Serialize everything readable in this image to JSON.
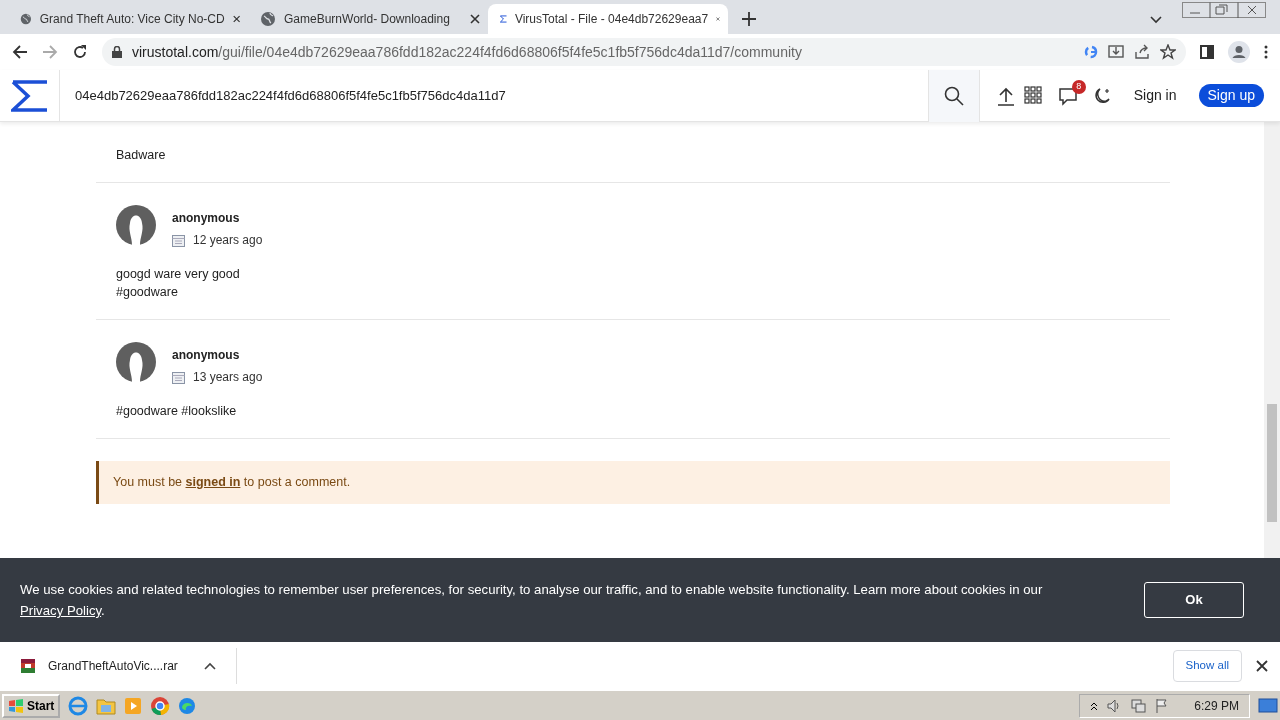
{
  "browser": {
    "tabs": [
      {
        "title": "Grand Theft Auto: Vice City No-CD",
        "kind": "generic",
        "selected": false
      },
      {
        "title": "GameBurnWorld- Downloading",
        "kind": "generic",
        "selected": false
      },
      {
        "title": "VirusTotal - File - 04e4db72629eaa7",
        "kind": "favicon",
        "selected": true
      }
    ],
    "address": {
      "domain": "virustotal.com",
      "path": "/gui/file/04e4db72629eaa786fdd182ac224f4fd6d68806f5f4fe5c1fb5f756dc4da11d7/community"
    }
  },
  "site_header": {
    "search_value": "04e4db72629eaa786fdd182ac224f4fd6d68806f5f4fe5c1fb5f756dc4da11d7",
    "notification_count": "8",
    "sign_in": "Sign in",
    "sign_up": "Sign up"
  },
  "comments": [
    {
      "lines": [
        "Badware"
      ]
    },
    {
      "author": "anonymous",
      "date": "12 years ago",
      "lines": [
        "googd ware very good",
        "#goodware"
      ]
    },
    {
      "author": "anonymous",
      "date": "13 years ago",
      "lines": [
        "#goodware #lookslike"
      ]
    }
  ],
  "signin_notice": {
    "prefix": "You must be",
    "link": "signed in",
    "suffix": "to post a comment."
  },
  "cookie_banner": {
    "text": "We use cookies and related technologies to remember user preferences, for security, to analyse our traffic, and to enable website functionality. Learn more about cookies in our",
    "link": "Privacy Policy",
    "suffix": ".",
    "button": "Ok"
  },
  "downloads": [
    {
      "filename": "GrandTheftAutoVic....rar"
    }
  ],
  "show_all": "Show all",
  "taskbar": {
    "start": "Start",
    "clock": "6:29 PM"
  }
}
